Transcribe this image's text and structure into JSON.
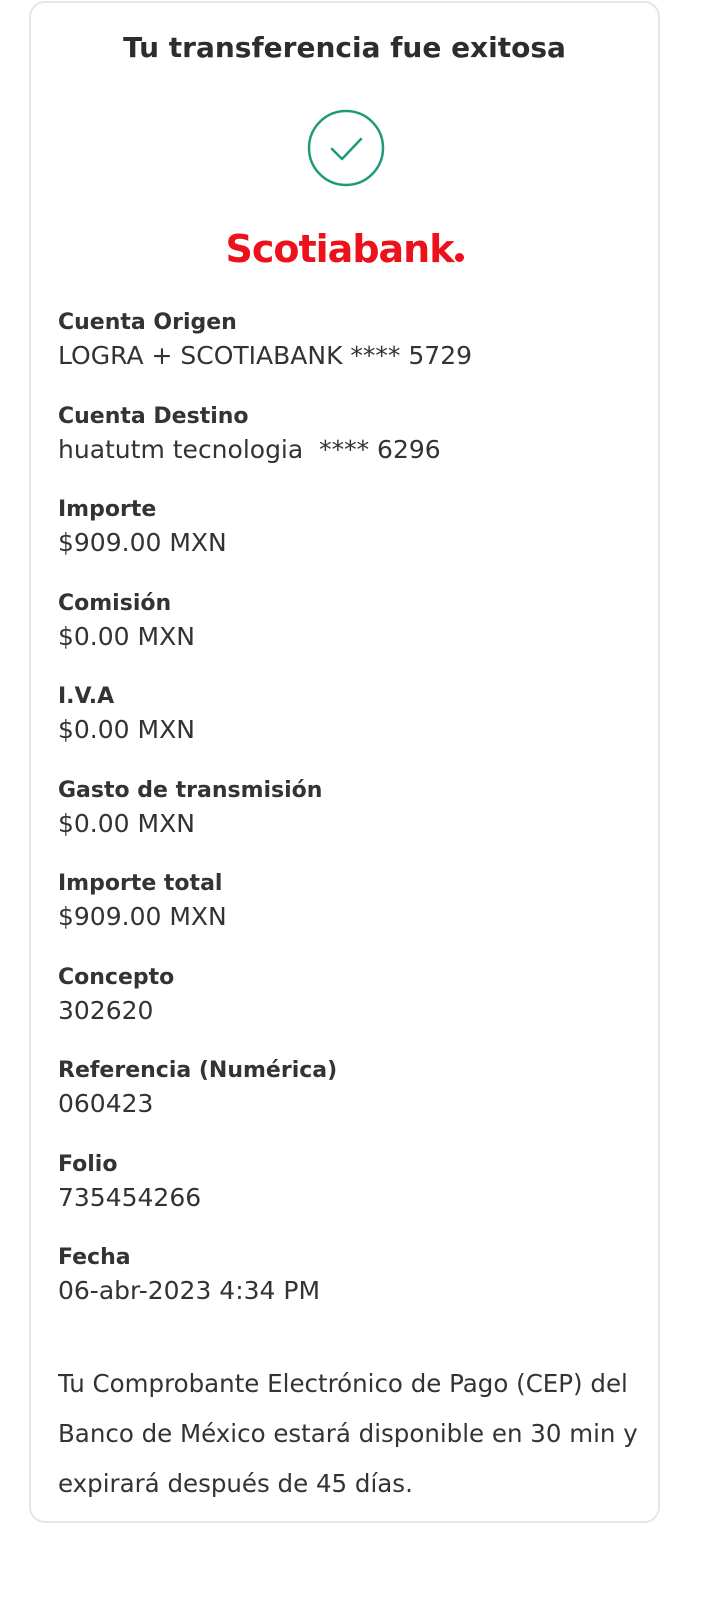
{
  "title": "Tu transferencia fue exitosa",
  "brand": {
    "name": "Scotiabank",
    "color": "#ec111a"
  },
  "status_icon": "check-circle-icon",
  "accent_color": "#1e9a7a",
  "fields": [
    {
      "label": "Cuenta Origen",
      "value": "LOGRA + SCOTIABANK **** 5729"
    },
    {
      "label": "Cuenta Destino",
      "value": "huatutm tecnologia  **** 6296"
    },
    {
      "label": "Importe",
      "value": "$909.00 MXN"
    },
    {
      "label": "Comisión",
      "value": "$0.00 MXN"
    },
    {
      "label": "I.V.A",
      "value": "$0.00 MXN"
    },
    {
      "label": "Gasto de transmisión",
      "value": "$0.00 MXN"
    },
    {
      "label": "Importe total",
      "value": "$909.00 MXN"
    },
    {
      "label": "Concepto",
      "value": "302620"
    },
    {
      "label": "Referencia (Numérica)",
      "value": "060423"
    },
    {
      "label": "Folio",
      "value": "735454266"
    },
    {
      "label": "Fecha",
      "value": "06-abr-2023 4:34 PM"
    }
  ],
  "notice": "Tu Comprobante Electrónico de Pago (CEP) del Banco de México estará disponible en 30 min y expirará después de 45 días."
}
